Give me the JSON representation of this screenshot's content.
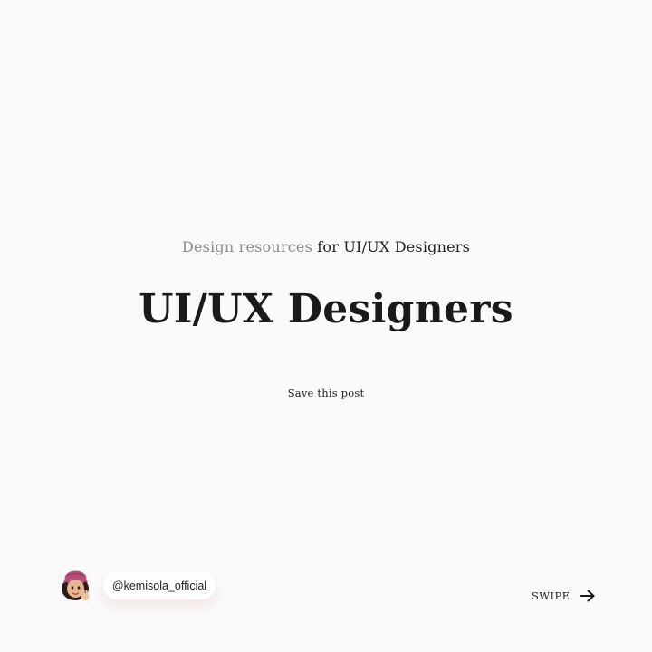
{
  "header": {
    "subtitle_muted": "Design resources",
    "subtitle_dark": "for UI/UX Designers",
    "title": "UI/UX Designers",
    "save_label": "Save this post"
  },
  "footer": {
    "handle": "@kemisola_official",
    "swipe_label": "SWIPE",
    "avatar_icon": "avatar-memoji-icon",
    "arrow_icon": "arrow-right-icon"
  },
  "colors": {
    "background": "#fbf9f9",
    "muted_text": "#8f8a8a",
    "dark_text": "#1a1a1a",
    "accent_pink": "#b54f79"
  }
}
